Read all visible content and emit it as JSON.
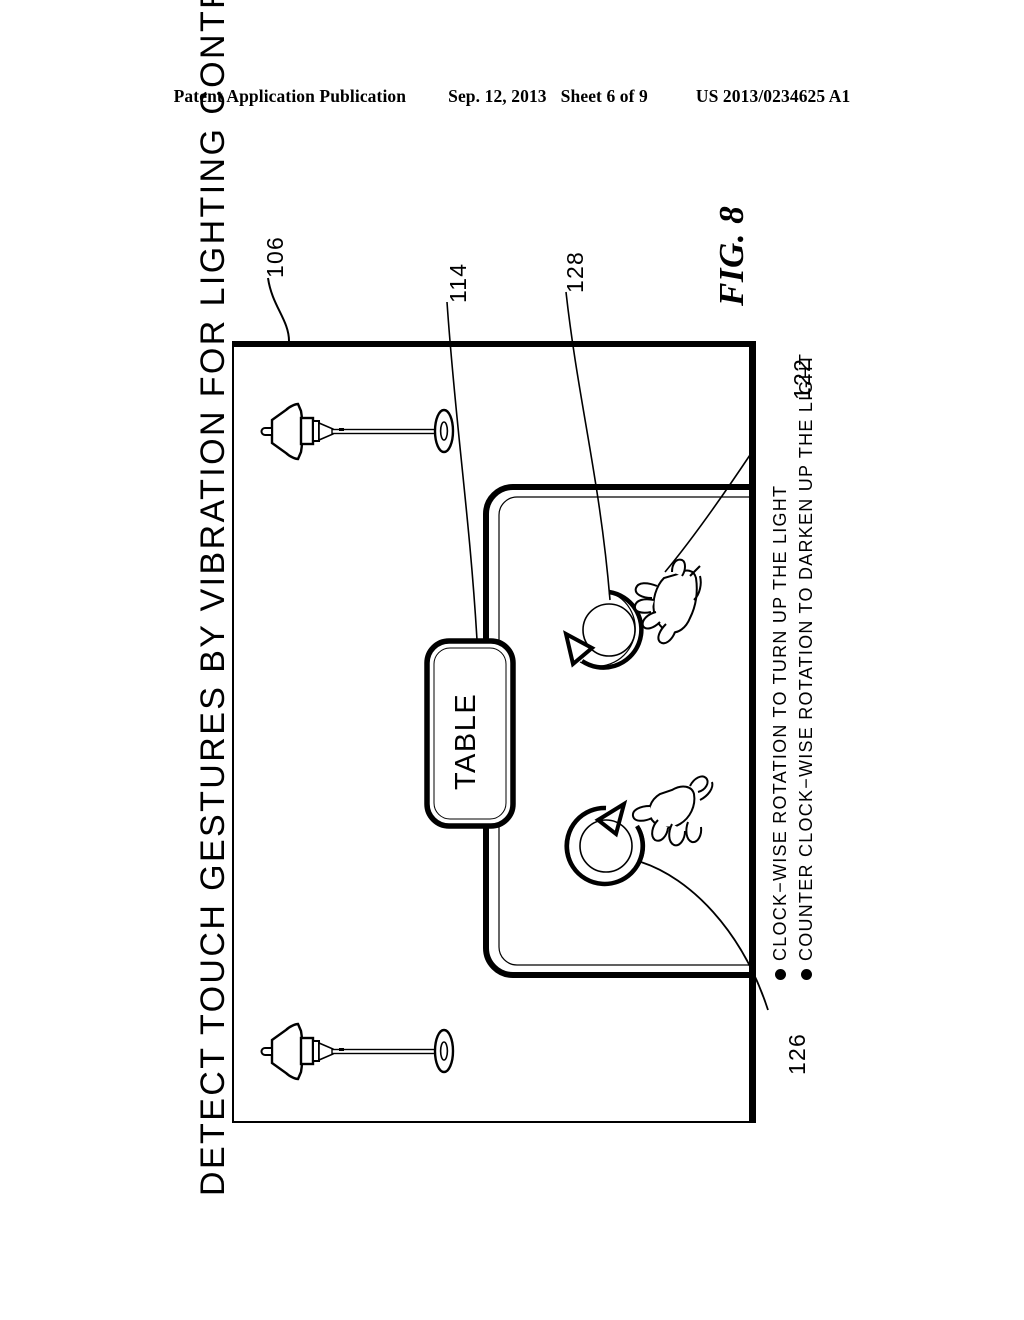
{
  "header": {
    "publication": "Patent Application Publication",
    "date": "Sep. 12, 2013",
    "sheet": "Sheet 6 of 9",
    "patent_number": "US 2013/0234625 A1"
  },
  "figure": {
    "title": "DETECT TOUCH GESTURES BY VIBRATION FOR LIGHTING CONTROL",
    "figure_label": "FIG. 8",
    "table_label": "TABLE",
    "reference_numerals": {
      "room": "106",
      "sofa": "114",
      "gesture_upper": "128",
      "wall_right": "122",
      "gesture_lower": "126"
    },
    "legend": [
      "CLOCK−WISE ROTATION TO TURN UP THE LIGHT",
      "COUNTER CLOCK−WISE ROTATION TO DARKEN UP THE LIGHT"
    ],
    "colors": {
      "line": "#000000",
      "background": "#ffffff"
    },
    "elements": {
      "lamp_top": "floor-lamp",
      "lamp_bottom": "floor-lamp",
      "gesture_upper_icon": "counter-clockwise-rotation-arrow",
      "gesture_lower_icon": "clockwise-rotation-arrow",
      "hand_upper": "hand-gesture",
      "hand_lower": "hand-gesture"
    }
  }
}
